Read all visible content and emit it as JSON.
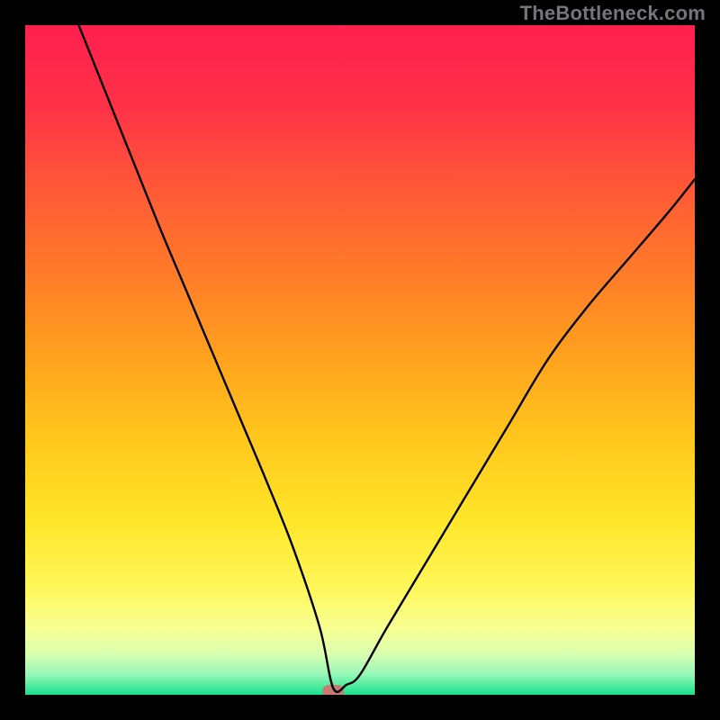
{
  "watermark": "TheBottleneck.com",
  "chart_data": {
    "type": "line",
    "title": "",
    "xlabel": "",
    "ylabel": "",
    "xlim": [
      0,
      100
    ],
    "ylim": [
      0,
      100
    ],
    "grid": false,
    "legend": false,
    "marker": {
      "x": 46,
      "y": 0,
      "color": "#c97a72"
    },
    "series": [
      {
        "name": "curve",
        "color": "#000000",
        "x": [
          8,
          12,
          16,
          20,
          24,
          28,
          32,
          36,
          40,
          44,
          46,
          48,
          50,
          54,
          60,
          66,
          72,
          78,
          84,
          90,
          96,
          100
        ],
        "y": [
          100,
          90,
          80,
          70,
          60.5,
          51,
          41.5,
          32,
          22,
          10,
          1,
          1.5,
          3,
          10,
          20,
          30,
          40,
          50,
          58,
          65,
          72,
          77
        ]
      }
    ],
    "background_gradient": {
      "stops": [
        {
          "offset": 0.0,
          "color": "#ff1f4f"
        },
        {
          "offset": 0.12,
          "color": "#ff3148"
        },
        {
          "offset": 0.25,
          "color": "#ff5a36"
        },
        {
          "offset": 0.38,
          "color": "#ff7e28"
        },
        {
          "offset": 0.5,
          "color": "#ffa31e"
        },
        {
          "offset": 0.62,
          "color": "#ffc71c"
        },
        {
          "offset": 0.74,
          "color": "#ffe62a"
        },
        {
          "offset": 0.84,
          "color": "#fff75a"
        },
        {
          "offset": 0.9,
          "color": "#f7ff91"
        },
        {
          "offset": 0.94,
          "color": "#d8ffb0"
        },
        {
          "offset": 0.97,
          "color": "#94f7b8"
        },
        {
          "offset": 1.0,
          "color": "#19e08c"
        }
      ]
    }
  }
}
